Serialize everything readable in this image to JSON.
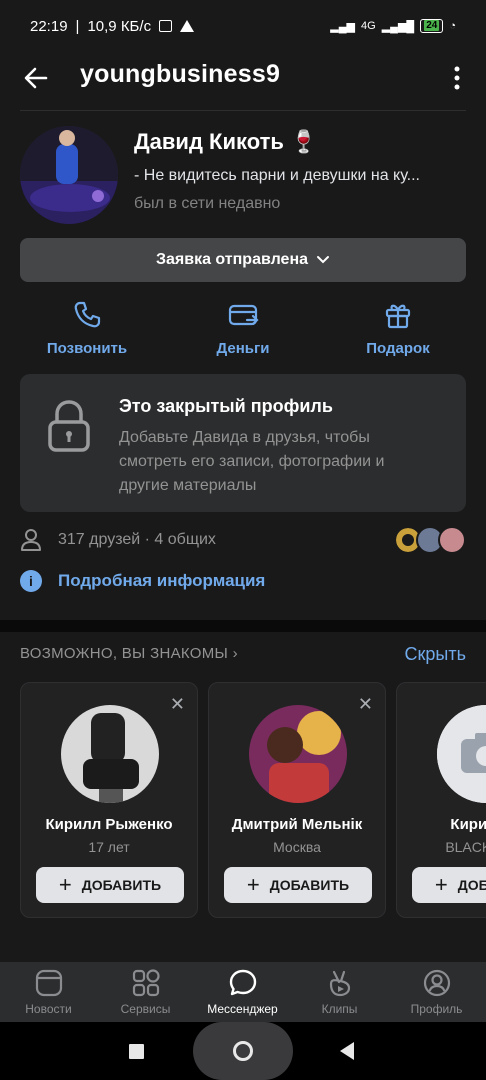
{
  "status_bar": {
    "time": "22:19",
    "speed": "10,9 КБ/с",
    "network": "4G",
    "battery": "24"
  },
  "header": {
    "title": "youngbusiness9"
  },
  "profile": {
    "name": "Давид Кикоть",
    "name_emoji": "🍷",
    "status": "- Не видитесь парни и девушки на ку...",
    "online": "был в сети недавно",
    "request_button": "Заявка отправлена"
  },
  "actions": [
    {
      "label": "Позвонить",
      "icon": "phone-icon"
    },
    {
      "label": "Деньги",
      "icon": "money-transfer-icon"
    },
    {
      "label": "Подарок",
      "icon": "gift-icon"
    }
  ],
  "closed_profile": {
    "title": "Это закрытый профиль",
    "text": "Добавьте Давида в друзья, чтобы смотреть его записи, фотографии и другие материалы"
  },
  "friends": {
    "text": "317 друзей · 4 общих"
  },
  "info": {
    "label": "Подробная информация"
  },
  "suggestions": {
    "heading": "ВОЗМОЖНО, ВЫ ЗНАКОМЫ",
    "hide": "Скрыть",
    "add_label": "ДОБАВИТЬ",
    "people": [
      {
        "name": "Кирилл Рыженко",
        "sub": "17 лет"
      },
      {
        "name": "Дмитрий Мельнік",
        "sub": "Москва"
      },
      {
        "name": "Кирилл К",
        "sub": "BLACK RUS"
      }
    ]
  },
  "tabs": [
    {
      "label": "Новости",
      "icon": "news-icon",
      "active": false
    },
    {
      "label": "Сервисы",
      "icon": "services-icon",
      "active": false
    },
    {
      "label": "Мессенджер",
      "icon": "messenger-icon",
      "active": true
    },
    {
      "label": "Клипы",
      "icon": "clips-icon",
      "active": false
    },
    {
      "label": "Профиль",
      "icon": "profile-icon",
      "active": false
    }
  ],
  "colors": {
    "background": "#19191a",
    "accent": "#71aaeb",
    "card": "#2c2d2e",
    "muted_text": "#939393"
  }
}
